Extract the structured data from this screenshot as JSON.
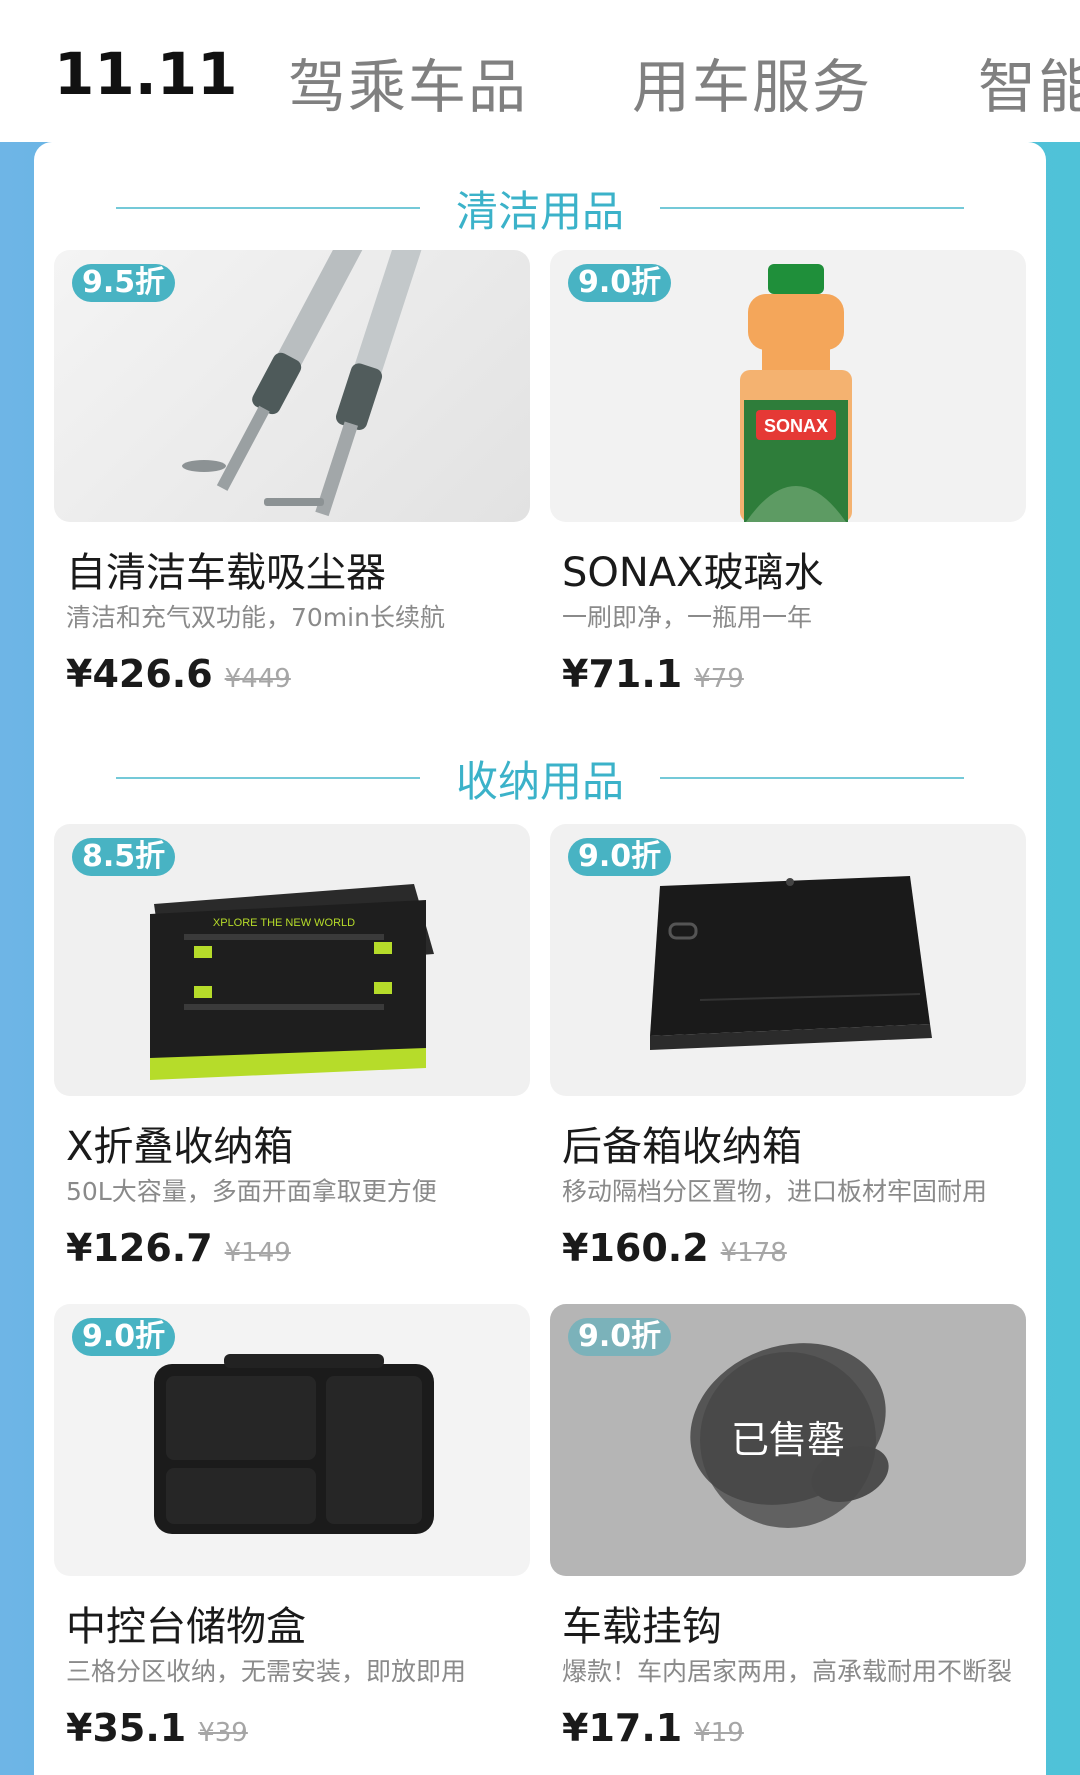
{
  "nav": {
    "tabs": [
      {
        "label": "11.11"
      },
      {
        "label": "驾乘车品"
      },
      {
        "label": "用车服务"
      },
      {
        "label": "智能"
      }
    ]
  },
  "sections": [
    {
      "title": "清洁用品",
      "products": [
        {
          "badge": "9.5折",
          "name": "自清洁车载吸尘器",
          "desc": "清洁和充气双功能，70min长续航",
          "price": "¥426.6",
          "original_price": "¥449",
          "image_icon": "vacuum-cleaner-icon"
        },
        {
          "badge": "9.0折",
          "name": "SONAX玻璃水",
          "desc": "一刷即净，一瓶用一年",
          "price": "¥71.1",
          "original_price": "¥79",
          "image_icon": "washer-fluid-bottle-icon",
          "image_label": "SONAX"
        }
      ]
    },
    {
      "title": "收纳用品",
      "products": [
        {
          "badge": "8.5折",
          "name": "X折叠收纳箱",
          "desc": "50L大容量，多面开面拿取更方便",
          "price": "¥126.7",
          "original_price": "¥149",
          "image_icon": "folding-storage-box-icon",
          "image_label": "XPLORE THE NEW WORLD"
        },
        {
          "badge": "9.0折",
          "name": "后备箱收纳箱",
          "desc": "移动隔档分区置物，进口板材牢固耐用",
          "price": "¥160.2",
          "original_price": "¥178",
          "image_icon": "trunk-organizer-icon"
        },
        {
          "badge": "9.0折",
          "name": "中控台储物盒",
          "desc": "三格分区收纳，无需安装，即放即用",
          "price": "¥35.1",
          "original_price": "¥39",
          "image_icon": "console-tray-icon"
        },
        {
          "badge": "9.0折",
          "name": "车载挂钩",
          "desc": "爆款！车内居家两用，高承载耐用不断裂",
          "price": "¥17.1",
          "original_price": "¥19",
          "image_icon": "car-hook-icon",
          "sold_out_label": "已售罄"
        }
      ]
    }
  ],
  "colors": {
    "accent": "#3bb2c9",
    "badge": "#48b3c3",
    "background_gradient": [
      "#6eb5e6",
      "#4fc2d8"
    ]
  }
}
